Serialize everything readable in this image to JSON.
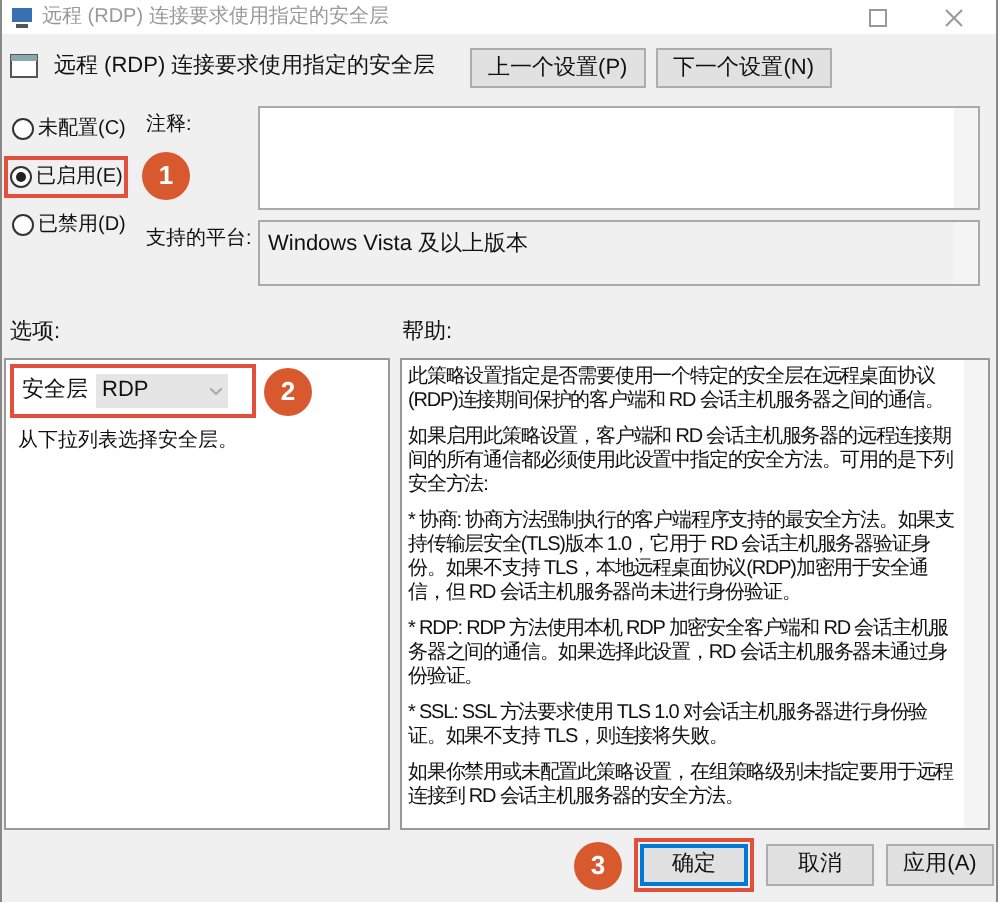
{
  "window": {
    "title": "远程 (RDP) 连接要求使用指定的安全层"
  },
  "policy": {
    "title": "远程 (RDP) 连接要求使用指定的安全层",
    "nav_buttons": [
      "上一个设置(P)",
      "下一个设置(N)"
    ]
  },
  "states": [
    {
      "label": "未配置(C)",
      "selected": false
    },
    {
      "label": "已启用(E)",
      "selected": true,
      "callout": "1"
    },
    {
      "label": "已禁用(D)",
      "selected": false
    }
  ],
  "comment": {
    "label": "注释:"
  },
  "platform": {
    "label": "支持的平台:",
    "value": "Windows Vista 及以上版本"
  },
  "options": {
    "label": "选项:",
    "field_label": "安全层",
    "dropdown_value": "RDP",
    "callout": "2",
    "hint": "从下拉列表选择安全层。"
  },
  "help": {
    "label": "帮助:",
    "paragraphs": [
      "此策略设置指定是否需要使用一个特定的安全层在远程桌面协议(RDP)连接期间保护的客户端和 RD 会话主机服务器之间的通信。",
      "如果启用此策略设置，客户端和 RD 会话主机服务器的远程连接期间的所有通信都必须使用此设置中指定的安全方法。可用的是下列安全方法:",
      "* 协商: 协商方法强制执行的客户端程序支持的最安全方法。如果支持传输层安全(TLS)版本 1.0，它用于 RD 会话主机服务器验证身份。如果不支持 TLS，本地远程桌面协议(RDP)加密用于安全通信，但 RD 会话主机服务器尚未进行身份验证。",
      "* RDP: RDP 方法使用本机 RDP 加密安全客户端和 RD 会话主机服务器之间的通信。如果选择此设置，RD 会话主机服务器未通过身份验证。",
      "* SSL: SSL 方法要求使用 TLS 1.0 对会话主机服务器进行身份验证。如果不支持 TLS，则连接将失败。",
      "如果你禁用或未配置此策略设置，在组策略级别未指定要用于远程连接到 RD 会话主机服务器的安全方法。"
    ]
  },
  "buttons": [
    {
      "label": "确定",
      "default": true,
      "callout": "3"
    },
    {
      "label": "取消",
      "default": false
    },
    {
      "label": "应用(A)",
      "default": false
    }
  ]
}
